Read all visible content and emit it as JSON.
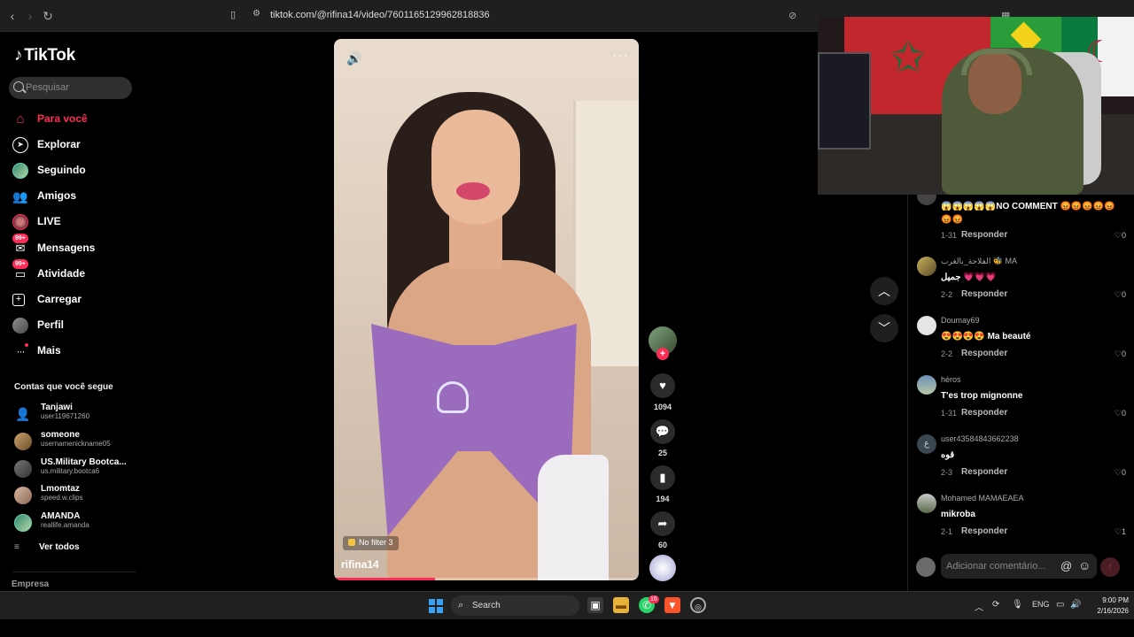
{
  "browser": {
    "url": "tiktok.com/@rifina14/video/7601165129962818836"
  },
  "sidebar": {
    "logo": "TikTok",
    "search_placeholder": "Pesquisar",
    "items": [
      {
        "label": "Para você",
        "icon": "home-icon",
        "active": true
      },
      {
        "label": "Explorar",
        "icon": "compass-icon"
      },
      {
        "label": "Seguindo",
        "icon": "following-avatar-icon"
      },
      {
        "label": "Amigos",
        "icon": "friends-icon"
      },
      {
        "label": "LIVE",
        "icon": "live-icon"
      },
      {
        "label": "Mensagens",
        "icon": "messages-icon",
        "badge": "99+"
      },
      {
        "label": "Atividade",
        "icon": "activity-icon",
        "badge": "99+"
      },
      {
        "label": "Carregar",
        "icon": "upload-icon"
      },
      {
        "label": "Perfil",
        "icon": "profile-avatar-icon"
      },
      {
        "label": "Mais",
        "icon": "more-icon"
      }
    ],
    "following_title": "Contas que você segue",
    "accounts": [
      {
        "name": "Tanjawi",
        "username": "user119671260"
      },
      {
        "name": "someone",
        "username": "usernamenickname05"
      },
      {
        "name": "US.Military Bootca...",
        "username": "us.military.bootca6"
      },
      {
        "name": "Lmomtaz",
        "username": "speed.w.clips"
      },
      {
        "name": "AMANDA",
        "username": "reallife.amanda"
      }
    ],
    "see_all": "Ver todos",
    "empresa": "Empresa"
  },
  "video": {
    "author": "rifina14",
    "filter_tag": "No filter 3",
    "progress": 0.33,
    "likes": "1094",
    "comments": "25",
    "saves": "194",
    "shares": "60"
  },
  "comments": {
    "items": [
      {
        "author": "",
        "text": "😱😱😱😱😱NO COMMENT 😡😡😡😡😡😡😡",
        "date": "1-31",
        "reply": "Responder",
        "likes": "0"
      },
      {
        "author": "الفلاحة_بالغرب 🐝 MA",
        "text": "جميل 💗💗💗",
        "date": "2-2",
        "reply": "Responder",
        "likes": "0"
      },
      {
        "author": "Doumay69",
        "text": "😍😍😍😍 Ma beauté",
        "date": "2-2",
        "reply": "Responder",
        "likes": "0"
      },
      {
        "author": "héros",
        "text": "T'es trop mignonne",
        "date": "1-31",
        "reply": "Responder",
        "likes": "0"
      },
      {
        "author": "user43584843662238",
        "text": "قوه",
        "date": "2-3",
        "reply": "Responder",
        "likes": "0"
      },
      {
        "author": "Mohamed MAMAEAEA",
        "text": "mikroba",
        "date": "2-1",
        "reply": "Responder",
        "likes": "1"
      }
    ],
    "add_placeholder": "Adicionar comentário..."
  },
  "taskbar": {
    "search_label": "Search",
    "lang": "ENG",
    "time": "9:00 PM",
    "date": "2/16/2026",
    "whatsapp_badge": "16"
  },
  "colors": {
    "accent": "#fe2c55",
    "background": "#000000"
  }
}
